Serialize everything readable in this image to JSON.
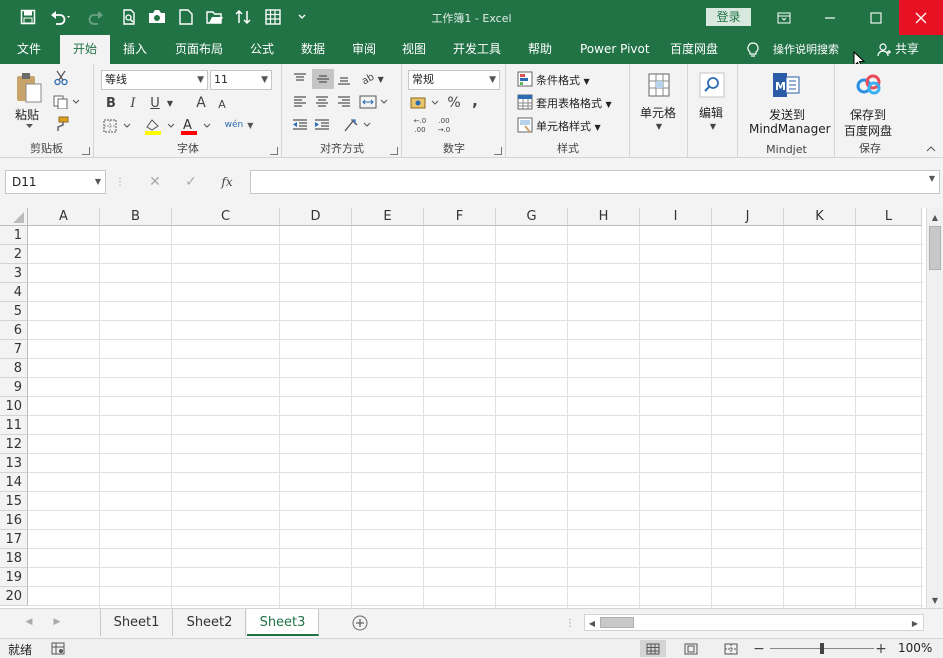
{
  "window": {
    "title": "工作簿1 - Excel",
    "login_label": "登录"
  },
  "ribbon": {
    "tabs": [
      "文件",
      "开始",
      "插入",
      "页面布局",
      "公式",
      "数据",
      "审阅",
      "视图",
      "开发工具",
      "帮助",
      "Power Pivot",
      "百度网盘"
    ],
    "active_tab": "开始",
    "search_label": "操作说明搜索",
    "share_label": "共享",
    "clipboard": {
      "paste_label": "粘贴",
      "group_label": "剪贴板"
    },
    "font": {
      "font_name": "等线",
      "font_size": "11",
      "bold": "B",
      "italic": "I",
      "underline": "U",
      "grow": "A",
      "shrink": "A",
      "font_color_glyph": "A",
      "phonetic": "wén",
      "group_label": "字体"
    },
    "alignment": {
      "group_label": "对齐方式",
      "orientation_glyph": "ab"
    },
    "number": {
      "format_value": "常规",
      "percent": "%",
      "comma": ",",
      "inc_decimal": "←.0 .00",
      "dec_decimal": ".00 →.0",
      "group_label": "数字"
    },
    "styles": {
      "conditional_format": "条件格式",
      "table_format": "套用表格格式",
      "cell_styles": "单元格样式",
      "group_label": "样式"
    },
    "cells": {
      "label": "单元格"
    },
    "editing": {
      "label": "编辑"
    },
    "mindjet": {
      "line1": "发送到",
      "line2": "MindManager",
      "group_label": "Mindjet"
    },
    "save": {
      "line1": "保存到",
      "line2": "百度网盘",
      "group_label": "保存"
    }
  },
  "formula_bar": {
    "name_box": "D11",
    "cancel": "✕",
    "enter": "✓",
    "fx": "fx",
    "formula": ""
  },
  "sheet": {
    "columns": [
      "A",
      "B",
      "C",
      "D",
      "E",
      "F",
      "G",
      "H",
      "I",
      "J",
      "K",
      "L"
    ],
    "rows": [
      "1",
      "2",
      "3",
      "4",
      "5",
      "6",
      "7",
      "8",
      "9",
      "10",
      "11",
      "12",
      "13",
      "14",
      "15",
      "16",
      "17",
      "18",
      "19",
      "20"
    ]
  },
  "sheet_tabs": {
    "tabs": [
      "Sheet1",
      "Sheet2",
      "Sheet3"
    ],
    "active": "Sheet3"
  },
  "status": {
    "ready": "就绪",
    "zoom": "100%",
    "zoom_out": "−",
    "zoom_in": "+"
  },
  "colors": {
    "excel_green": "#217346",
    "close_red": "#e81123",
    "highlight_yellow": "#ffff00",
    "font_red": "#ff0000"
  }
}
